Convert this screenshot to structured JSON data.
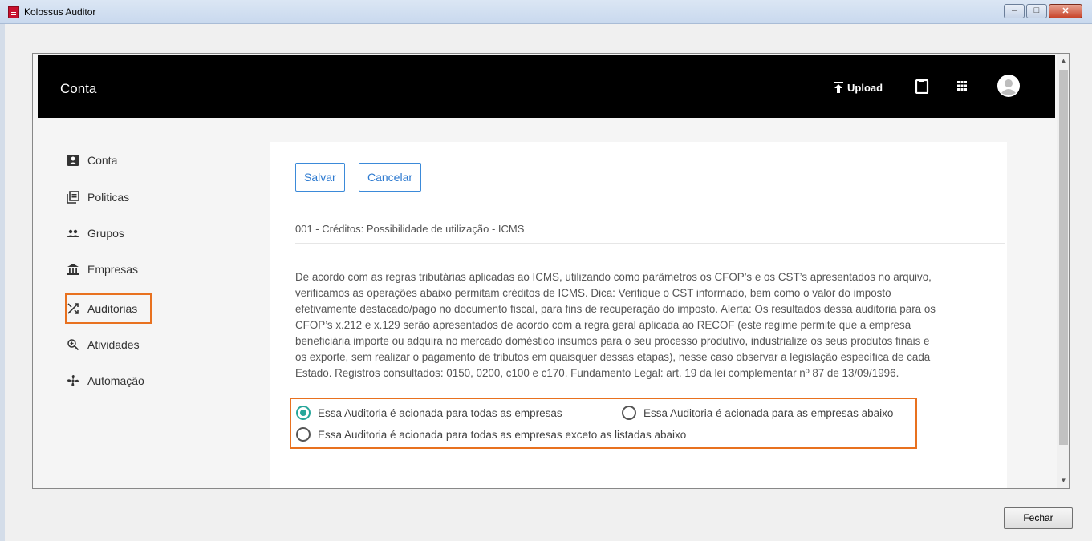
{
  "window": {
    "title": "Kolossus Auditor",
    "minimize_glyph": "‒",
    "maximize_glyph": "□",
    "close_glyph": "✕"
  },
  "header": {
    "title": "Conta",
    "upload_label": "Upload"
  },
  "sidebar": {
    "items": [
      {
        "label": "Conta",
        "icon": "account-box-icon"
      },
      {
        "label": "Politicas",
        "icon": "library-books-icon"
      },
      {
        "label": "Grupos",
        "icon": "people-icon"
      },
      {
        "label": "Empresas",
        "icon": "bank-icon"
      },
      {
        "label": "Auditorias",
        "icon": "shuffle-icon"
      },
      {
        "label": "Atividades",
        "icon": "zoom-icon"
      },
      {
        "label": "Automação",
        "icon": "fan-icon"
      }
    ]
  },
  "card": {
    "save_label": "Salvar",
    "cancel_label": "Cancelar",
    "rule_title": "001 - Créditos: Possibilidade de utilização - ICMS",
    "description_lines": [
      "De acordo com as regras tributárias aplicadas ao ICMS, utilizando como parâmetros os CFOP’s e os CST’s apresentados no arquivo,",
      "verificamos as operações abaixo permitam créditos de ICMS. Dica: Verifique o CST informado, bem como o valor do imposto",
      "efetivamente destacado/pago no documento fiscal, para fins de recuperação do imposto. Alerta: Os resultados dessa auditoria para os",
      "CFOP’s x.212 e x.129 serão apresentados de acordo com a regra geral aplicada ao RECOF (este regime permite que a empresa",
      "beneficiária importe ou adquira no mercado doméstico insumos para o seu processo produtivo, industrialize os seus produtos finais e",
      "os exporte, sem realizar o pagamento de tributos em quaisquer dessas etapas), nesse caso observar a legislação específica de cada",
      "Estado. Registros consultados: 0150, 0200, c100 e c170. Fundamento Legal: art. 19 da lei complementar nº 87 de 13/09/1996."
    ],
    "radio_options": [
      {
        "label": "Essa Auditoria é acionada para todas as empresas",
        "checked": true
      },
      {
        "label": "Essa Auditoria é acionada para as empresas abaixo",
        "checked": false
      },
      {
        "label": "Essa Auditoria é acionada para todas as empresas exceto as listadas abaixo",
        "checked": false
      }
    ]
  },
  "footer": {
    "close_label": "Fechar"
  },
  "colors": {
    "accent": "#2d7ad0",
    "highlight": "#e8711f",
    "radio_checked": "#26a69a"
  }
}
